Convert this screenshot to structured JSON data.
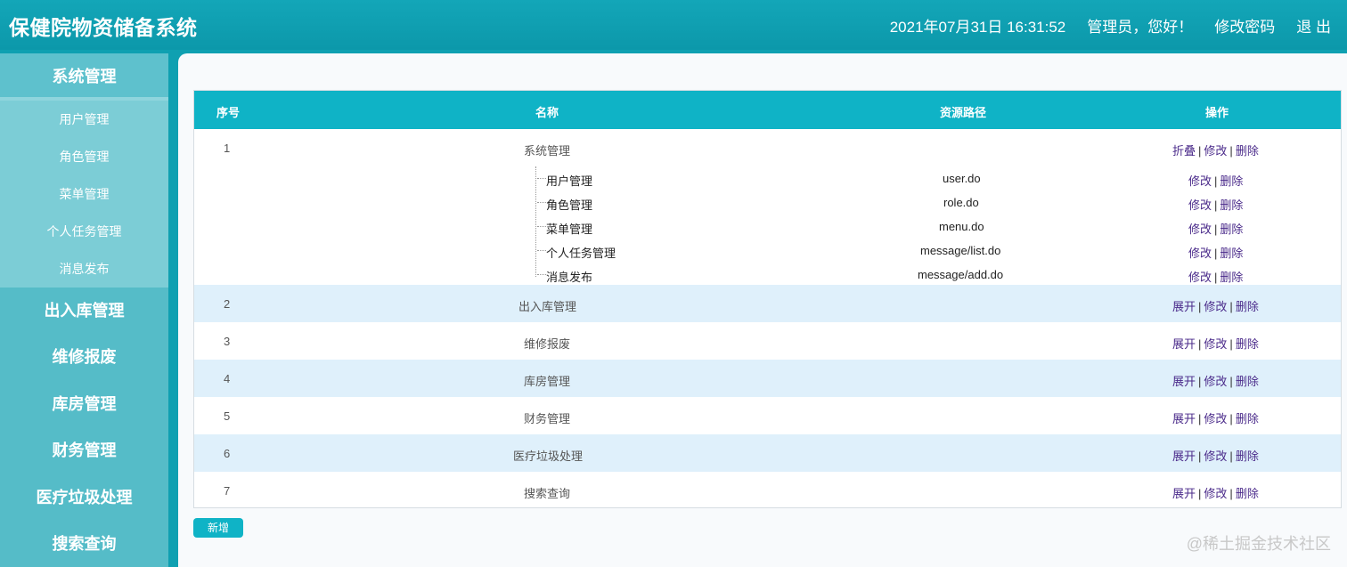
{
  "header": {
    "app_title": "保健院物资储备系统",
    "datetime": "2021年07月31日 16:31:52",
    "greeting": "管理员，您好！",
    "change_password": "修改密码",
    "logout": "退 出"
  },
  "sidebar": {
    "active_group": "系统管理",
    "sub_items": [
      "用户管理",
      "角色管理",
      "菜单管理",
      "个人任务管理",
      "消息发布"
    ],
    "groups": [
      "出入库管理",
      "维修报废",
      "库房管理",
      "财务管理",
      "医疗垃圾处理",
      "搜索查询"
    ]
  },
  "table": {
    "columns": [
      "序号",
      "名称",
      "资源路径",
      "操作"
    ],
    "rows": [
      {
        "no": "1",
        "name": "系统管理",
        "toggle": "折叠",
        "edit": "修改",
        "delete": "删除",
        "children": [
          {
            "name": "用户管理",
            "path": "user.do",
            "edit": "修改",
            "delete": "删除"
          },
          {
            "name": "角色管理",
            "path": "role.do",
            "edit": "修改",
            "delete": "删除"
          },
          {
            "name": "菜单管理",
            "path": "menu.do",
            "edit": "修改",
            "delete": "删除"
          },
          {
            "name": "个人任务管理",
            "path": "message/list.do",
            "edit": "修改",
            "delete": "删除"
          },
          {
            "name": "消息发布",
            "path": "message/add.do",
            "edit": "修改",
            "delete": "删除"
          }
        ]
      },
      {
        "no": "2",
        "name": "出入库管理",
        "toggle": "展开",
        "edit": "修改",
        "delete": "删除"
      },
      {
        "no": "3",
        "name": "维修报废",
        "toggle": "展开",
        "edit": "修改",
        "delete": "删除"
      },
      {
        "no": "4",
        "name": "库房管理",
        "toggle": "展开",
        "edit": "修改",
        "delete": "删除"
      },
      {
        "no": "5",
        "name": "财务管理",
        "toggle": "展开",
        "edit": "修改",
        "delete": "删除"
      },
      {
        "no": "6",
        "name": "医疗垃圾处理",
        "toggle": "展开",
        "edit": "修改",
        "delete": "删除"
      },
      {
        "no": "7",
        "name": "搜索查询",
        "toggle": "展开",
        "edit": "修改",
        "delete": "删除"
      }
    ]
  },
  "add_button": "新增",
  "watermark": "@稀土掘金技术社区",
  "colors": {
    "header": "#0fa0b1",
    "table_header": "#0fb3c6",
    "alt_row": "#dff0fb",
    "sidebar": "#55bcc8"
  }
}
